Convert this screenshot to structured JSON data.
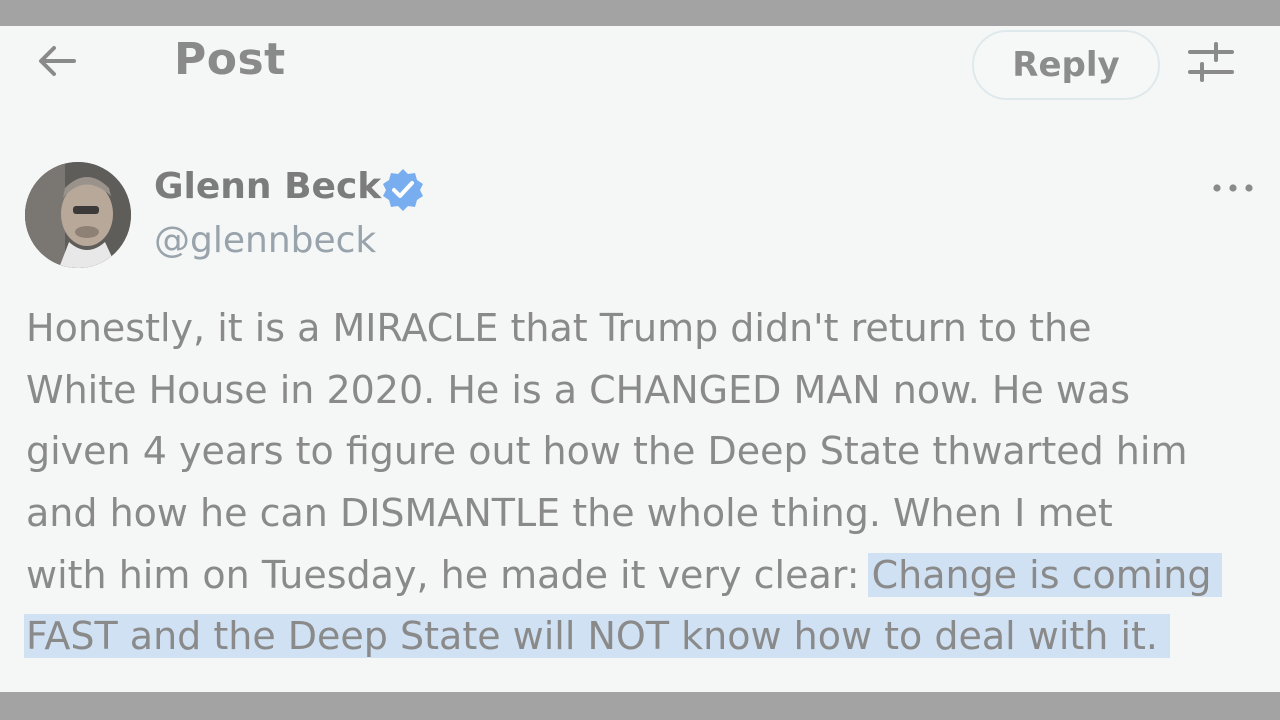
{
  "header": {
    "title": "Post",
    "reply_label": "Reply",
    "back_icon": "arrow-left-icon",
    "filter_icon": "sliders-icon"
  },
  "author": {
    "name": "Glenn Beck",
    "handle": "@glennbeck",
    "verified": true,
    "verified_color": "#78aef0"
  },
  "post": {
    "lines": [
      "Honestly, it is a MIRACLE that Trump didn't return to the",
      "White House in 2020. He is a CHANGED MAN now. He was",
      "given 4 years to figure out how the Deep State thwarted him",
      "and how he can DISMANTLE the whole thing. When I met",
      "with him on Tuesday, he made it very clear: "
    ],
    "highlight_1": "Change is coming",
    "highlight_2": "FAST and the Deep State will NOT know how to deal with it.",
    "highlight_color": "#cfe1f3"
  },
  "colors": {
    "background": "#f5f6f6",
    "text": "#8a8a8a",
    "frame": "#a3a3a3"
  }
}
